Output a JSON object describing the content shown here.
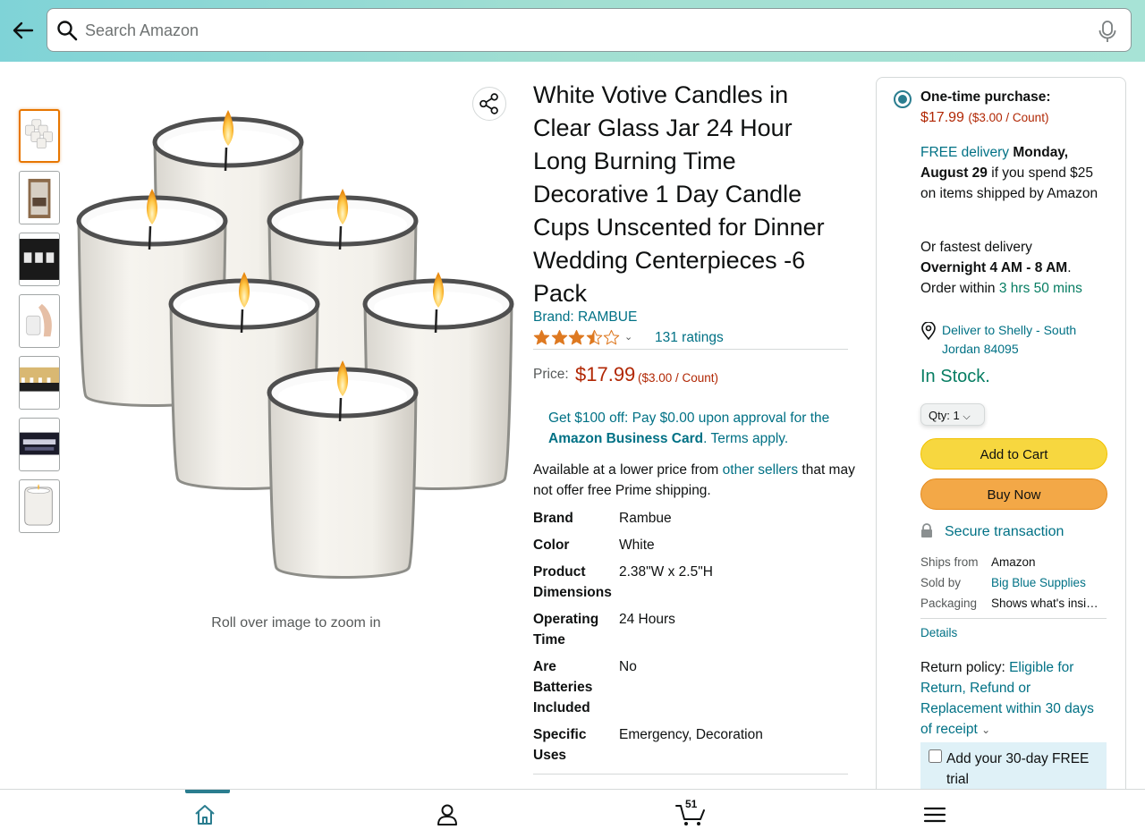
{
  "search": {
    "placeholder": "Search Amazon"
  },
  "product": {
    "title": "White Votive Candles in Clear Glass Jar 24 Hour Long Burning Time Decorative 1 Day Candle Cups Unscented for Dinner Wedding Centerpieces -6 Pack",
    "brand": "Brand: RAMBUE",
    "rating": 3.5,
    "ratings_count": "131 ratings",
    "price_label": "Price:",
    "price": "$17.99",
    "unit_price": "($3.00 / Count)",
    "zoom_hint": "Roll over image to zoom in",
    "promo_pre": "Get $100 off: Pay $0.00 upon approval for the ",
    "promo_bold": "Amazon Business Card",
    "promo_post": ". Terms apply.",
    "avail_pre": "Available at a lower price from ",
    "avail_link": "other sellers",
    "avail_post": " that may not offer free Prime shipping.",
    "specs": [
      {
        "key": "Brand",
        "value": "Rambue"
      },
      {
        "key": "Color",
        "value": "White"
      },
      {
        "key": "Product Dimensions",
        "value": "2.38\"W x 2.5\"H"
      },
      {
        "key": "Operating Time",
        "value": "24 Hours"
      },
      {
        "key": "Are Batteries Included",
        "value": "No"
      },
      {
        "key": "Specific Uses",
        "value": "Emergency, Decoration"
      }
    ]
  },
  "buybox": {
    "purchase_option": "One-time purchase:",
    "price": "$17.99",
    "unit_price": "($3.00 / Count)",
    "free_delivery": "FREE delivery",
    "delivery_date": "Monday, August 29",
    "delivery_condition": " if you spend $25 on items shipped by Amazon",
    "fastest_pre": "Or fastest delivery",
    "fastest_window": "Overnight 4 AM - 8 AM",
    "order_within_pre": "Order within ",
    "order_within": "3 hrs 50 mins",
    "deliver_to": "Deliver to Shelly - South Jordan 84095",
    "stock": "In Stock.",
    "qty_label": "Qty:",
    "qty_value": "1",
    "add_to_cart": "Add to Cart",
    "buy_now": "Buy Now",
    "secure": "Secure transaction",
    "ships_from_label": "Ships from",
    "ships_from": "Amazon",
    "sold_by_label": "Sold by",
    "sold_by": "Big Blue Supplies",
    "packaging_label": "Packaging",
    "packaging": "Shows what's insi…",
    "details": "Details",
    "return_pre": "Return policy: ",
    "return_link": "Eligible for Return, Refund or Replacement within 30 days of receipt",
    "trial": "Add your 30-day FREE trial"
  },
  "nav": {
    "cart_count": "51"
  },
  "colors": {
    "accent": "#007185",
    "price": "#b12704",
    "stock": "#067d62",
    "cart_button": "#f7d73f",
    "buy_button": "#f3a847"
  },
  "icons": [
    "back-arrow-icon",
    "search-icon",
    "microphone-icon",
    "share-icon",
    "star-icon",
    "location-pin-icon",
    "lock-icon",
    "home-icon",
    "account-icon",
    "cart-icon",
    "menu-icon"
  ]
}
